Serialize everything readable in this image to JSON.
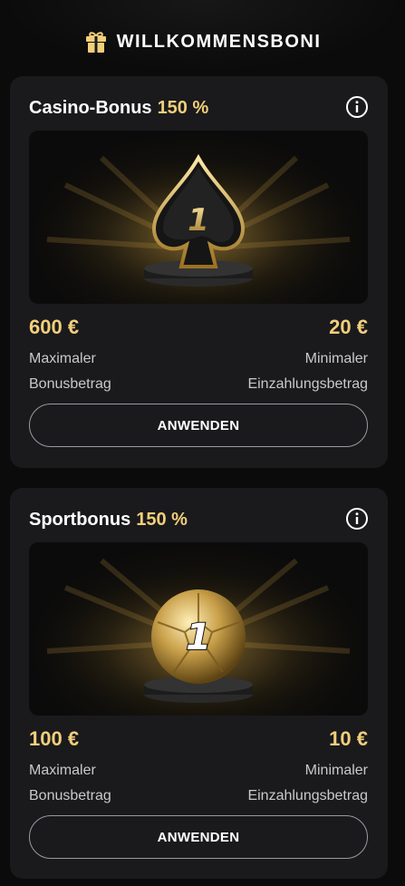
{
  "header": {
    "title": "WILLKOMMENSBONI",
    "icon": "gift-icon"
  },
  "colors": {
    "accent": "#f2cf7a",
    "card_bg": "#1a1a1d",
    "page_bg": "#0b0b0c"
  },
  "bonuses": [
    {
      "title": "Casino-Bonus",
      "percent": "150 %",
      "image": "spade-trophy",
      "max_amount": "600 €",
      "max_label_1": "Maximaler",
      "max_label_2": "Bonusbetrag",
      "min_amount": "20 €",
      "min_label_1": "Minimaler",
      "min_label_2": "Einzahlungsbetrag",
      "button": "ANWENDEN"
    },
    {
      "title": "Sportbonus",
      "percent": "150 %",
      "image": "football-trophy",
      "max_amount": "100 €",
      "max_label_1": "Maximaler",
      "max_label_2": "Bonusbetrag",
      "min_amount": "10 €",
      "min_label_1": "Minimaler",
      "min_label_2": "Einzahlungsbetrag",
      "button": "ANWENDEN"
    }
  ],
  "hero_numeral": "1"
}
